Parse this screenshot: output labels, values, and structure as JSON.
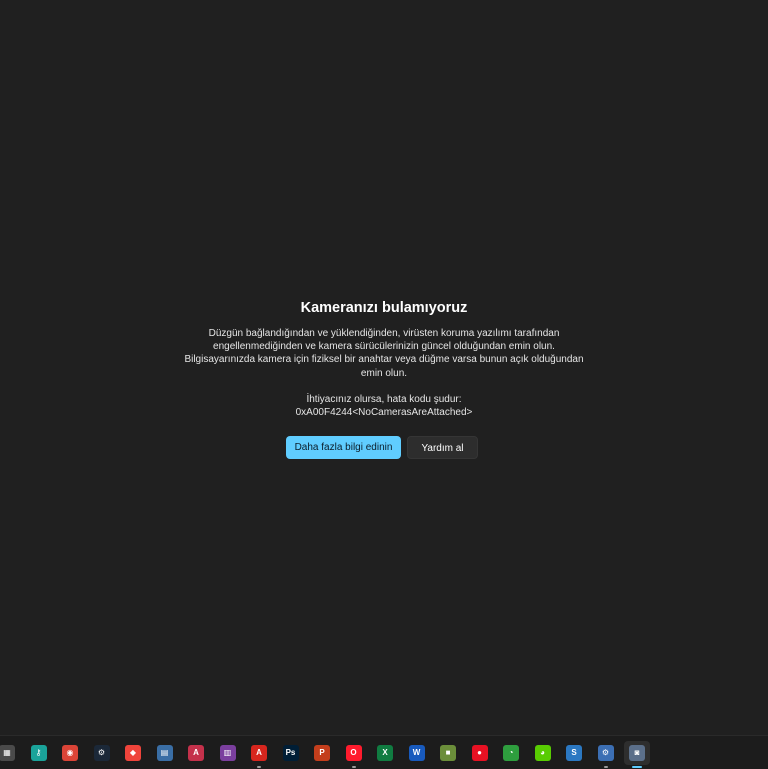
{
  "error": {
    "title": "Kameranızı bulamıyoruz",
    "body": "Düzgün bağlandığından ve yüklendiğinden, virüsten koruma yazılımı tarafından engellenmediğinden ve kamera sürücülerinizin güncel olduğundan emin olun. Bilgisayarınızda kamera için fiziksel bir anahtar veya düğme varsa bunun açık olduğundan emin olun.",
    "code_label": "İhtiyacınız olursa, hata kodu şudur:",
    "code": "0xA00F4244<NoCamerasAreAttached>",
    "primary_button": "Daha fazla bilgi edinin",
    "secondary_button": "Yardım al"
  },
  "taskbar": {
    "apps": [
      {
        "name": "calculator-icon",
        "glyph": "▦",
        "color": "#4a4a4a",
        "running": false
      },
      {
        "name": "key-app-icon",
        "glyph": "⚷",
        "color": "#1aa39a",
        "running": false
      },
      {
        "name": "chrome-icon",
        "glyph": "◉",
        "color": "#db4437",
        "running": false
      },
      {
        "name": "steam-icon",
        "glyph": "⚙",
        "color": "#1b2838",
        "running": false
      },
      {
        "name": "anydesk-icon",
        "glyph": "◆",
        "color": "#ef443b",
        "running": false
      },
      {
        "name": "screen-app-icon",
        "glyph": "▤",
        "color": "#3a6ea5",
        "running": false
      },
      {
        "name": "access-icon",
        "glyph": "A",
        "color": "#c4314b",
        "running": false
      },
      {
        "name": "winrar-icon",
        "glyph": "▥",
        "color": "#7b3f9e",
        "running": false
      },
      {
        "name": "acrobat-icon",
        "glyph": "A",
        "color": "#d7261e",
        "running": true
      },
      {
        "name": "photoshop-icon",
        "glyph": "Ps",
        "color": "#001e36",
        "running": false
      },
      {
        "name": "powerpoint-icon",
        "glyph": "P",
        "color": "#c43e1c",
        "running": false
      },
      {
        "name": "opera-icon",
        "glyph": "O",
        "color": "#ff1b2d",
        "running": true
      },
      {
        "name": "excel-icon",
        "glyph": "X",
        "color": "#107c41",
        "running": false
      },
      {
        "name": "word-icon",
        "glyph": "W",
        "color": "#185abd",
        "running": false
      },
      {
        "name": "minecraft-icon",
        "glyph": "■",
        "color": "#6b8e3a",
        "running": false
      },
      {
        "name": "record-icon",
        "glyph": "●",
        "color": "#e81123",
        "running": false
      },
      {
        "name": "green-app-icon",
        "glyph": "◔",
        "color": "#2e9e3e",
        "running": false
      },
      {
        "name": "duolingo-icon",
        "glyph": "◕",
        "color": "#58cc02",
        "running": false
      },
      {
        "name": "s-app-icon",
        "glyph": "S",
        "color": "#2b78c2",
        "running": false
      },
      {
        "name": "settings-icon",
        "glyph": "⚙",
        "color": "#3c6fb4",
        "running": true
      },
      {
        "name": "camera-icon",
        "glyph": "◙",
        "color": "#5b6f8a",
        "running": true,
        "active": true
      }
    ]
  }
}
